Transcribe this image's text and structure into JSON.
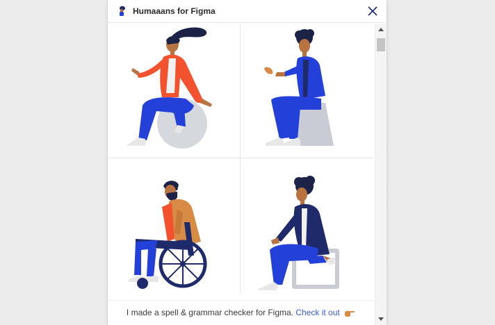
{
  "window": {
    "title": "Humaaans for Figma"
  },
  "illustrations": [
    {
      "name": "woman-on-exercise-ball"
    },
    {
      "name": "man-sitting-on-stool"
    },
    {
      "name": "man-in-wheelchair"
    },
    {
      "name": "woman-sitting-on-chair"
    }
  ],
  "footer": {
    "text": "I made a spell & grammar checker for Figma.",
    "link_label": "Check it out",
    "icon": "pointing-hand-icon"
  },
  "colors": {
    "accent": "#3a5bd9",
    "figure_blue": "#2340d8",
    "figure_navy": "#1f2a6b",
    "figure_red": "#f24e2e",
    "figure_orange": "#d78b45",
    "prop_gray": "#c9cdd3"
  }
}
